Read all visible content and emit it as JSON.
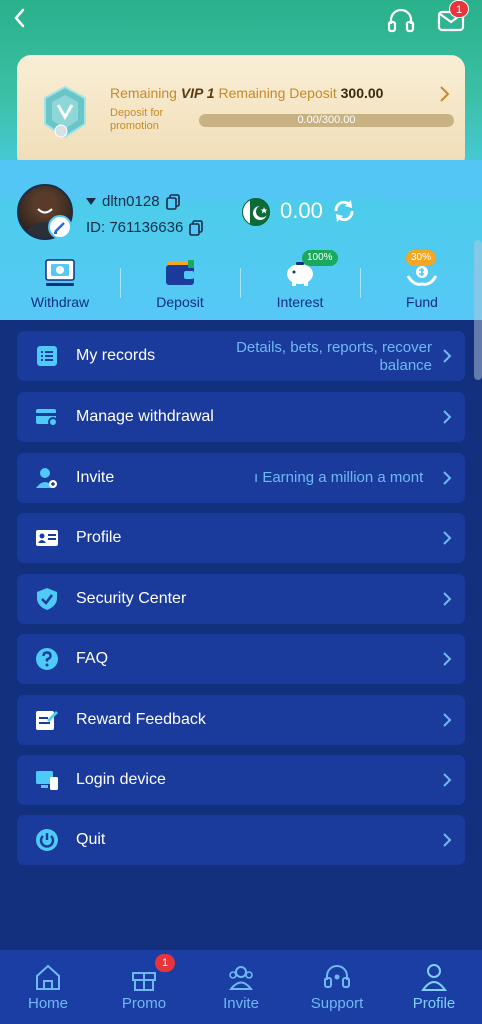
{
  "header": {
    "back_icon": "chevron-left-icon",
    "support_icon": "headset-icon",
    "mail_icon": "mail-icon",
    "mail_badge": "1"
  },
  "vip": {
    "remaining_prefix": "Remaining",
    "level": "VIP 1",
    "remaining_deposit_label": "Remaining Deposit",
    "remaining_deposit_amount": "300.00",
    "deposit_note": "Deposit for promotion",
    "progress_text": "0.00/300.00",
    "progress_fraction": 0.0
  },
  "user": {
    "username": "dltn0128",
    "id": "ID: 761136636",
    "balance": "0.00"
  },
  "quick_actions": [
    {
      "label": "Withdraw",
      "icon": "withdraw-icon"
    },
    {
      "label": "Deposit",
      "icon": "wallet-icon"
    },
    {
      "label": "Interest",
      "icon": "piggy-bank-icon",
      "badge": "100%"
    },
    {
      "label": "Fund",
      "icon": "fund-hands-icon",
      "badge": "30%"
    }
  ],
  "menu": [
    {
      "label": "My records",
      "hint": "Details, bets, reports, recover balance",
      "icon": "records-list-icon"
    },
    {
      "label": "Manage withdrawal",
      "hint": "",
      "icon": "card-settings-icon"
    },
    {
      "label": "Invite",
      "hint": "ı Earning a million a mont",
      "icon": "user-invite-icon"
    },
    {
      "label": "Profile",
      "hint": "",
      "icon": "id-card-icon"
    },
    {
      "label": "Security Center",
      "hint": "",
      "icon": "shield-check-icon"
    },
    {
      "label": "FAQ",
      "hint": "",
      "icon": "question-circle-icon"
    },
    {
      "label": "Reward Feedback",
      "hint": "",
      "icon": "edit-note-icon"
    },
    {
      "label": "Login device",
      "hint": "",
      "icon": "devices-icon"
    },
    {
      "label": "Quit",
      "hint": "",
      "icon": "power-icon"
    }
  ],
  "bottom_nav": [
    {
      "label": "Home",
      "icon": "home-icon"
    },
    {
      "label": "Promo",
      "icon": "gift-icon",
      "badge": "1"
    },
    {
      "label": "Invite",
      "icon": "users-icon"
    },
    {
      "label": "Support",
      "icon": "headset-icon"
    },
    {
      "label": "Profile",
      "icon": "user-icon",
      "active": true
    }
  ],
  "colors": {
    "page_bg": "#13307e",
    "menu_item_bg": "#1a3b9c",
    "hint_text": "#6fb9f3",
    "vip_gold": "#c78a2a",
    "badge_red": "#e8353b"
  }
}
